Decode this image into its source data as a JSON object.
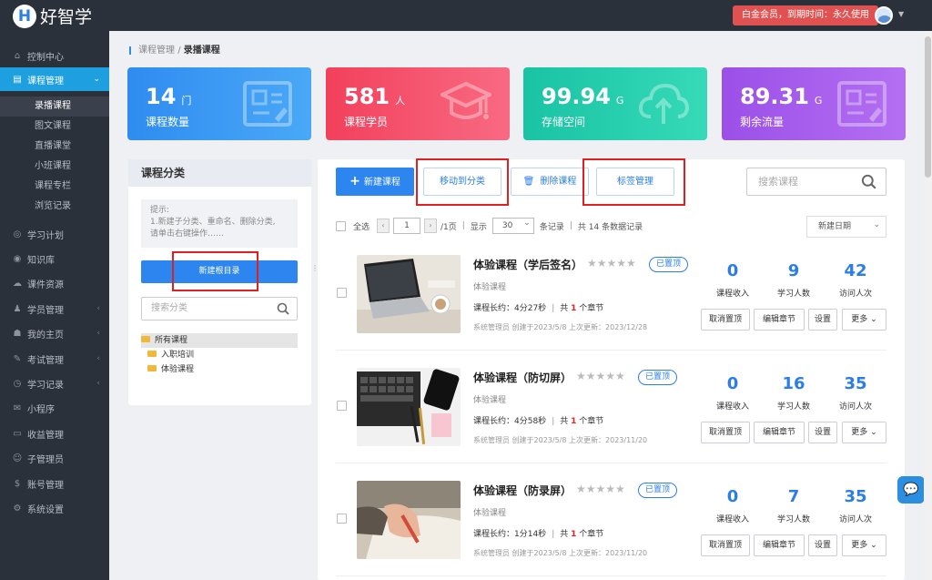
{
  "topbar": {
    "logo_letter": "H",
    "logo_text": "好智学",
    "vip_text": "白金会员，到期时间：永久使用"
  },
  "sidebar": {
    "items": [
      {
        "icon": "home-icon",
        "glyph": "⌂",
        "label": "控制中心"
      },
      {
        "icon": "book-icon",
        "glyph": "▤",
        "label": "课程管理",
        "active": true
      },
      {
        "icon": "plan-icon",
        "glyph": "◎",
        "label": "学习计划"
      },
      {
        "icon": "knowledge-icon",
        "glyph": "◉",
        "label": "知识库"
      },
      {
        "icon": "cloud-icon",
        "glyph": "☁",
        "label": "课件资源"
      },
      {
        "icon": "students-icon",
        "glyph": "♟",
        "label": "学员管理"
      },
      {
        "icon": "homepage-icon",
        "glyph": "☗",
        "label": "我的主页"
      },
      {
        "icon": "exam-icon",
        "glyph": "✎",
        "label": "考试管理"
      },
      {
        "icon": "record-icon",
        "glyph": "◷",
        "label": "学习记录"
      },
      {
        "icon": "wechat-icon",
        "glyph": "✉",
        "label": "小程序"
      },
      {
        "icon": "income-icon",
        "glyph": "▭",
        "label": "收益管理"
      },
      {
        "icon": "sub-admin-icon",
        "glyph": "☺",
        "label": "子管理员"
      },
      {
        "icon": "account-icon",
        "glyph": "$",
        "label": "账号管理"
      },
      {
        "icon": "settings-icon",
        "glyph": "⚙",
        "label": "系统设置"
      }
    ],
    "sub_items": [
      "录播课程",
      "图文课程",
      "直播课堂",
      "小班课程",
      "课程专栏",
      "浏览记录"
    ]
  },
  "breadcrumb": {
    "parent": "课程管理",
    "separator": "/",
    "current": "录播课程"
  },
  "stats": [
    {
      "value": "14",
      "unit": "门",
      "label": "课程数量",
      "color": "#2f8cf0"
    },
    {
      "value": "581",
      "unit": "人",
      "label": "课程学员",
      "color": "#f2405c"
    },
    {
      "value": "99.94",
      "unit": "G",
      "label": "存储空间",
      "color": "#19c3a4"
    },
    {
      "value": "89.31",
      "unit": "G",
      "label": "剩余流量",
      "color": "#9b4fe8"
    }
  ],
  "category": {
    "title": "课程分类",
    "tip_lines": [
      "提示:",
      "1.新建子分类、重命名、删除分类,",
      "请单击右键操作……"
    ],
    "new_root_label": "新建根目录",
    "search_placeholder": "搜索分类",
    "tree": [
      "所有课程",
      "入职培训",
      "体验课程"
    ]
  },
  "toolbar": {
    "new_course": "新建课程",
    "move_to_category": "移动到分类",
    "delete_course": "删除课程",
    "tag_manage": "标签管理",
    "search_placeholder": "搜索课程"
  },
  "pager": {
    "all_label": "全选",
    "page": "1",
    "total_pages": "/1页",
    "show_label": "显示",
    "page_size": "30",
    "records_label": "条记录",
    "total_text": "共 14 条数据记录",
    "sort_label": "新建日期"
  },
  "courses": [
    {
      "title": "体验课程（学后签名）",
      "badge": "已置顶",
      "category": "体验课程",
      "duration_prefix": "课程长约：4分27秒",
      "chapters_prefix": "共",
      "chapters": "1",
      "chapters_suffix": "个章节",
      "meta": "系统管理员 创建于2023/5/8 上次更新：2023/12/28",
      "income": "0",
      "learners": "9",
      "visitors": "42"
    },
    {
      "title": "体验课程（防切屏）",
      "badge": "已置顶",
      "category": "体验课程",
      "duration_prefix": "课程长约：4分58秒",
      "chapters_prefix": "共",
      "chapters": "1",
      "chapters_suffix": "个章节",
      "meta": "系统管理员 创建于2023/5/8 上次更新：2023/11/20",
      "income": "0",
      "learners": "16",
      "visitors": "35"
    },
    {
      "title": "体验课程（防录屏）",
      "badge": "已置顶",
      "category": "体验课程",
      "duration_prefix": "课程长约：1分14秒",
      "chapters_prefix": "共",
      "chapters": "1",
      "chapters_suffix": "个章节",
      "meta": "系统管理员 创建于2023/5/8 上次更新：2023/11/20",
      "income": "0",
      "learners": "7",
      "visitors": "35"
    }
  ],
  "course_labels": {
    "income": "课程收入",
    "learners": "学习人数",
    "visitors": "访问人次",
    "unpin": "取消置顶",
    "edit_chapters": "编辑章节",
    "settings": "设置",
    "more": "更多 ⌄",
    "stars": "★★★★★"
  },
  "highlight_color": "#e02020"
}
